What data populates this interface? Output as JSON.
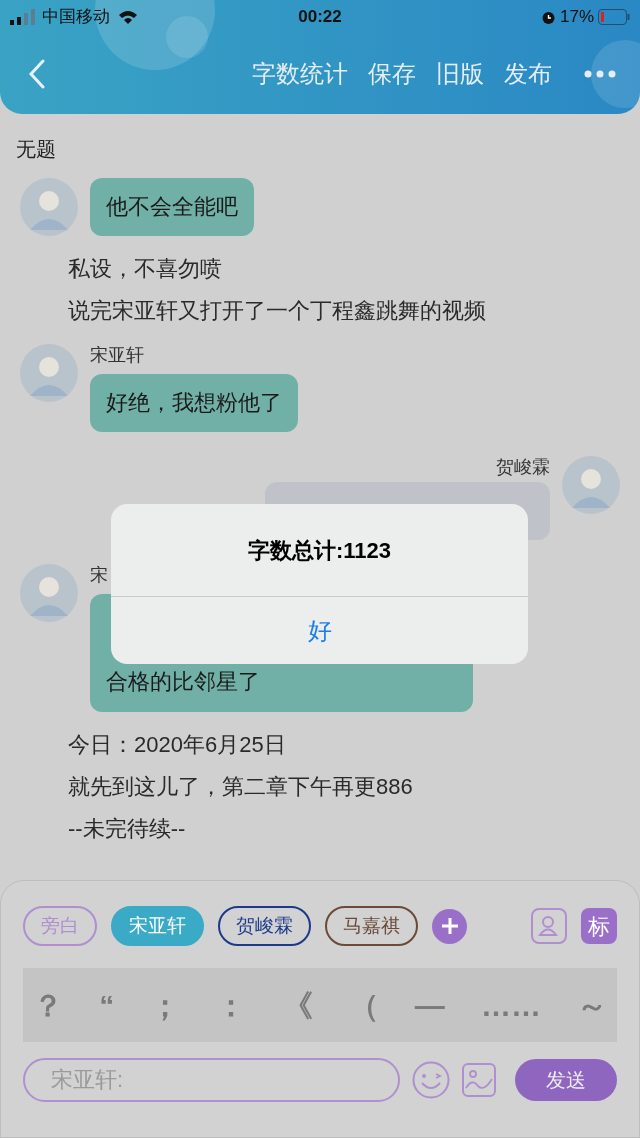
{
  "status_bar": {
    "carrier": "中国移动",
    "time": "00:22",
    "battery": "17%"
  },
  "nav": {
    "actions": [
      "字数统计",
      "保存",
      "旧版",
      "发布"
    ]
  },
  "title": "无题",
  "messages": [
    {
      "kind": "left",
      "text": "他不会全能吧"
    },
    {
      "kind": "narration",
      "text": "私设，不喜勿喷"
    },
    {
      "kind": "narration",
      "text": "说完宋亚轩又打开了一个丁程鑫跳舞的视频"
    },
    {
      "kind": "left",
      "name": "宋亚轩",
      "text": "好绝，我想粉他了"
    },
    {
      "kind": "right",
      "name": "贺峻霖"
    },
    {
      "kind": "left",
      "name": "宋",
      "text": "合格的比邻星了",
      "covered": true
    },
    {
      "kind": "narration",
      "text": "今日：2020年6月25日"
    },
    {
      "kind": "narration",
      "text": "就先到这儿了，第二章下午再更886"
    },
    {
      "kind": "narration",
      "text": "--未完待续--"
    }
  ],
  "alert": {
    "title": "字数总计:1123",
    "button": "好"
  },
  "roles": [
    {
      "label": "旁白",
      "color": "#b08fd0",
      "selected": false
    },
    {
      "label": "宋亚轩",
      "color": "#3aaac6",
      "selected": true
    },
    {
      "label": "贺峻霖",
      "color": "#1d3a8a",
      "selected": false
    },
    {
      "label": "马嘉祺",
      "color": "#6b4a3a",
      "selected": false
    }
  ],
  "mark_button": "标",
  "punctuation": [
    "？",
    "“",
    "；",
    "：",
    "《",
    "（",
    "—",
    "……",
    "～"
  ],
  "input": {
    "placeholder": "宋亚轩:"
  },
  "send_button": "发送"
}
